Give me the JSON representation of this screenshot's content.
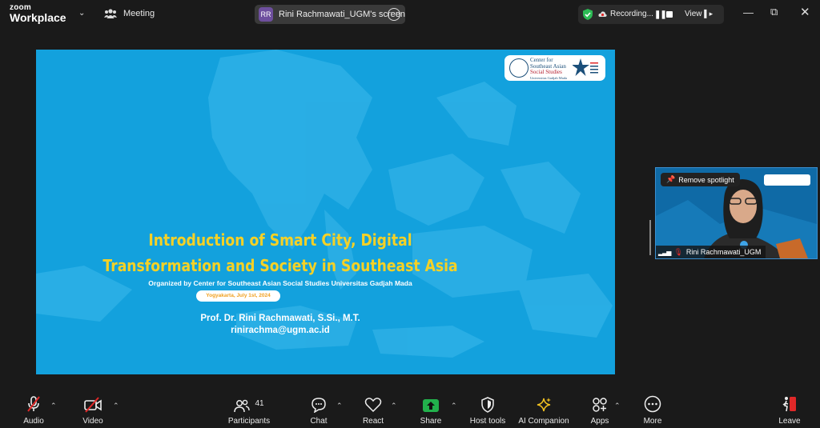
{
  "app": {
    "logo_line1": "zoom",
    "logo_line2": "Workplace"
  },
  "header": {
    "meeting_label": "Meeting",
    "share": {
      "avatar_initials": "RR",
      "label": "Rini Rachmawati_UGM's screen"
    },
    "recording": {
      "label": "Recording...",
      "view_label": "View"
    }
  },
  "slide": {
    "logo_lines": [
      "Center for",
      "Southeast Asian",
      "Social Studies",
      "Universitas Gadjah Mada"
    ],
    "title_line1": "Introduction of Smart City, Digital",
    "title_line2": "Transformation and Society in Southeast Asia",
    "organizer": "Organized by Center for Southeast Asian Social Studies Universitas Gadjah Mada",
    "date": "Yogyakarta, July 1st, 2024",
    "presenter_name": "Prof. Dr. Rini Rachmawati, S.Si., M.T.",
    "presenter_email": "rinirachma@ugm.ac.id"
  },
  "video_tile": {
    "spotlight_button": "Remove spotlight",
    "participant_name": "Rini Rachmawati_UGM"
  },
  "toolbar": {
    "audio": "Audio",
    "video": "Video",
    "participants": "Participants",
    "participant_count": "41",
    "chat": "Chat",
    "react": "React",
    "share": "Share",
    "host_tools": "Host tools",
    "ai_companion": "AI Companion",
    "apps": "Apps",
    "more": "More",
    "leave": "Leave"
  },
  "colors": {
    "slide_bg": "#13a1dd",
    "title_yellow": "#f5d126",
    "share_green": "#22b14c",
    "leave_red": "#e02828",
    "muted_red": "#e02828"
  }
}
